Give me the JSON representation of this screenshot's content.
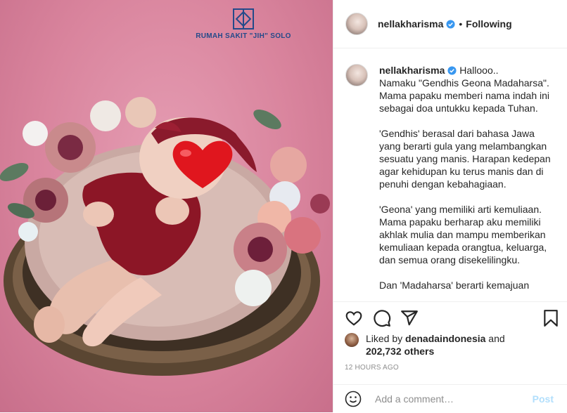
{
  "post_image": {
    "logo_text": "RUMAH SAKIT \"JIH\" SOLO",
    "description": "",
    "heart_emoji": "heart"
  },
  "header": {
    "username": "nellakharisma",
    "separator": "•",
    "follow_status": "Following"
  },
  "caption": {
    "username": "nellakharisma",
    "text": " Hallooo..\nNamaku \"Gendhis Geona Madaharsa\". Mama papaku memberi nama indah ini sebagai doa untukku kepada Tuhan.\n\n'Gendhis' berasal dari bahasa Jawa yang berarti gula yang melambangkan sesuatu yang manis. Harapan kedepan agar kehidupan ku terus manis dan di penuhi dengan kebahagiaan.\n\n'Geona' yang memiliki arti kemuliaan. Mama papaku berharap aku memiliki akhlak mulia dan mampu memberikan kemuliaan kepada orangtua, keluarga, dan semua orang disekelilingku.\n\nDan 'Madaharsa' berarti kemajuan"
  },
  "actions": {
    "like": "heart-icon",
    "comment": "comment-icon",
    "share": "share-icon",
    "save": "bookmark-icon"
  },
  "likes": {
    "prefix": "Liked by ",
    "first_liker": "denadaindonesia",
    "joiner": " and",
    "count": "202,732 others"
  },
  "timestamp": "12 HOURS AGO",
  "comment_box": {
    "placeholder": "Add a comment…",
    "post_label": "Post"
  },
  "colors": {
    "verified": "#3897f0",
    "background_pink": "#d9849d",
    "post_disabled": "#b2dffc",
    "logo_blue": "#244a8a"
  }
}
